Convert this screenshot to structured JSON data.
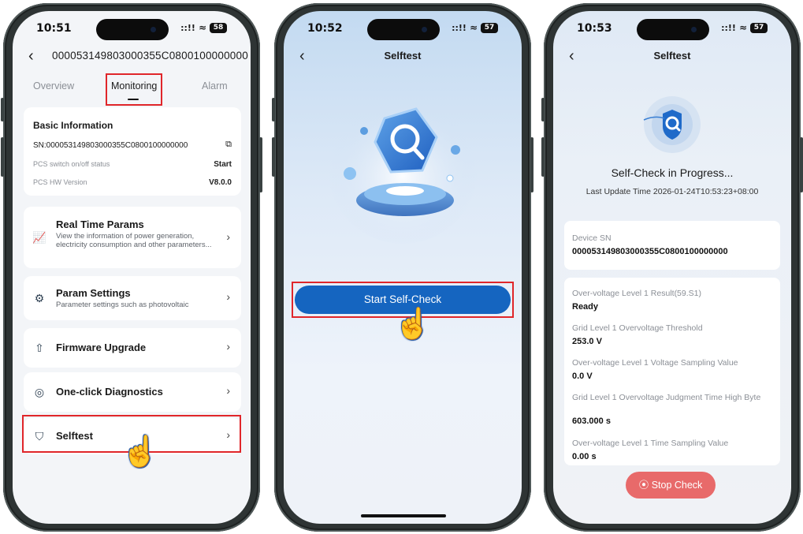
{
  "phone1": {
    "status": {
      "time": "10:51",
      "battery": "58",
      "signal": "::!!",
      "wifi": "≈"
    },
    "header": {
      "back": "‹",
      "title": "00005314980300035 5C0800100000000"
    },
    "tabs": [
      {
        "label": "Overview"
      },
      {
        "label": "Monitoring"
      },
      {
        "label": "Alarm"
      }
    ],
    "basic_info": {
      "title": "Basic Information",
      "sn": "SN:000053149803000355C0800100000000",
      "rows": [
        {
          "label": "PCS switch on/off status",
          "value": "Start"
        },
        {
          "label": "PCS HW Version",
          "value": "V8.0.0"
        }
      ]
    },
    "menu": [
      {
        "title": "Real Time Params",
        "desc": "View the information of power generation, electricity consumption and other parameters...",
        "icon": "monitor-chart-icon"
      },
      {
        "title": "Param Settings",
        "desc": "Parameter settings such as photovoltaic",
        "icon": "settings-doc-icon"
      },
      {
        "title": "Firmware Upgrade",
        "desc": "",
        "icon": "upgrade-icon"
      },
      {
        "title": "One-click Diagnostics",
        "desc": "",
        "icon": "diagnostics-icon"
      },
      {
        "title": "Selftest",
        "desc": "",
        "icon": "shield-icon"
      }
    ],
    "chevron": "›"
  },
  "phone2": {
    "status": {
      "time": "10:52",
      "battery": "57",
      "signal": "::!!",
      "wifi": "≈"
    },
    "header": {
      "back": "‹",
      "title": "Selftest"
    },
    "start_button": "Start Self-Check"
  },
  "phone3": {
    "status": {
      "time": "10:53",
      "battery": "57",
      "signal": "::!!",
      "wifi": "≈"
    },
    "header": {
      "back": "‹",
      "title": "Selftest"
    },
    "progress_title": "Self-Check in Progress...",
    "last_update": "Last Update Time 2026-01-24T10:53:23+08:00",
    "device": {
      "label": "Device SN",
      "value": "000053149803000355C0800100000000"
    },
    "items": [
      {
        "label": "Over-voltage Level 1 Result(59.S1)",
        "value": "Ready"
      },
      {
        "label": "Grid Level 1 Overvoltage Threshold",
        "value": "253.0 V"
      },
      {
        "label": "Over-voltage Level 1 Voltage Sampling Value",
        "value": "0.0 V"
      },
      {
        "label": "Grid Level 1 Overvoltage Judgment Time High Byte",
        "value": "603.000 s"
      },
      {
        "label": "Over-voltage Level 1 Time Sampling Value",
        "value": "0.00 s"
      }
    ],
    "stop_button": "Stop Check"
  },
  "colors": {
    "primary": "#1565c0",
    "highlight": "#e0262a",
    "stop": "#e86a6a"
  }
}
